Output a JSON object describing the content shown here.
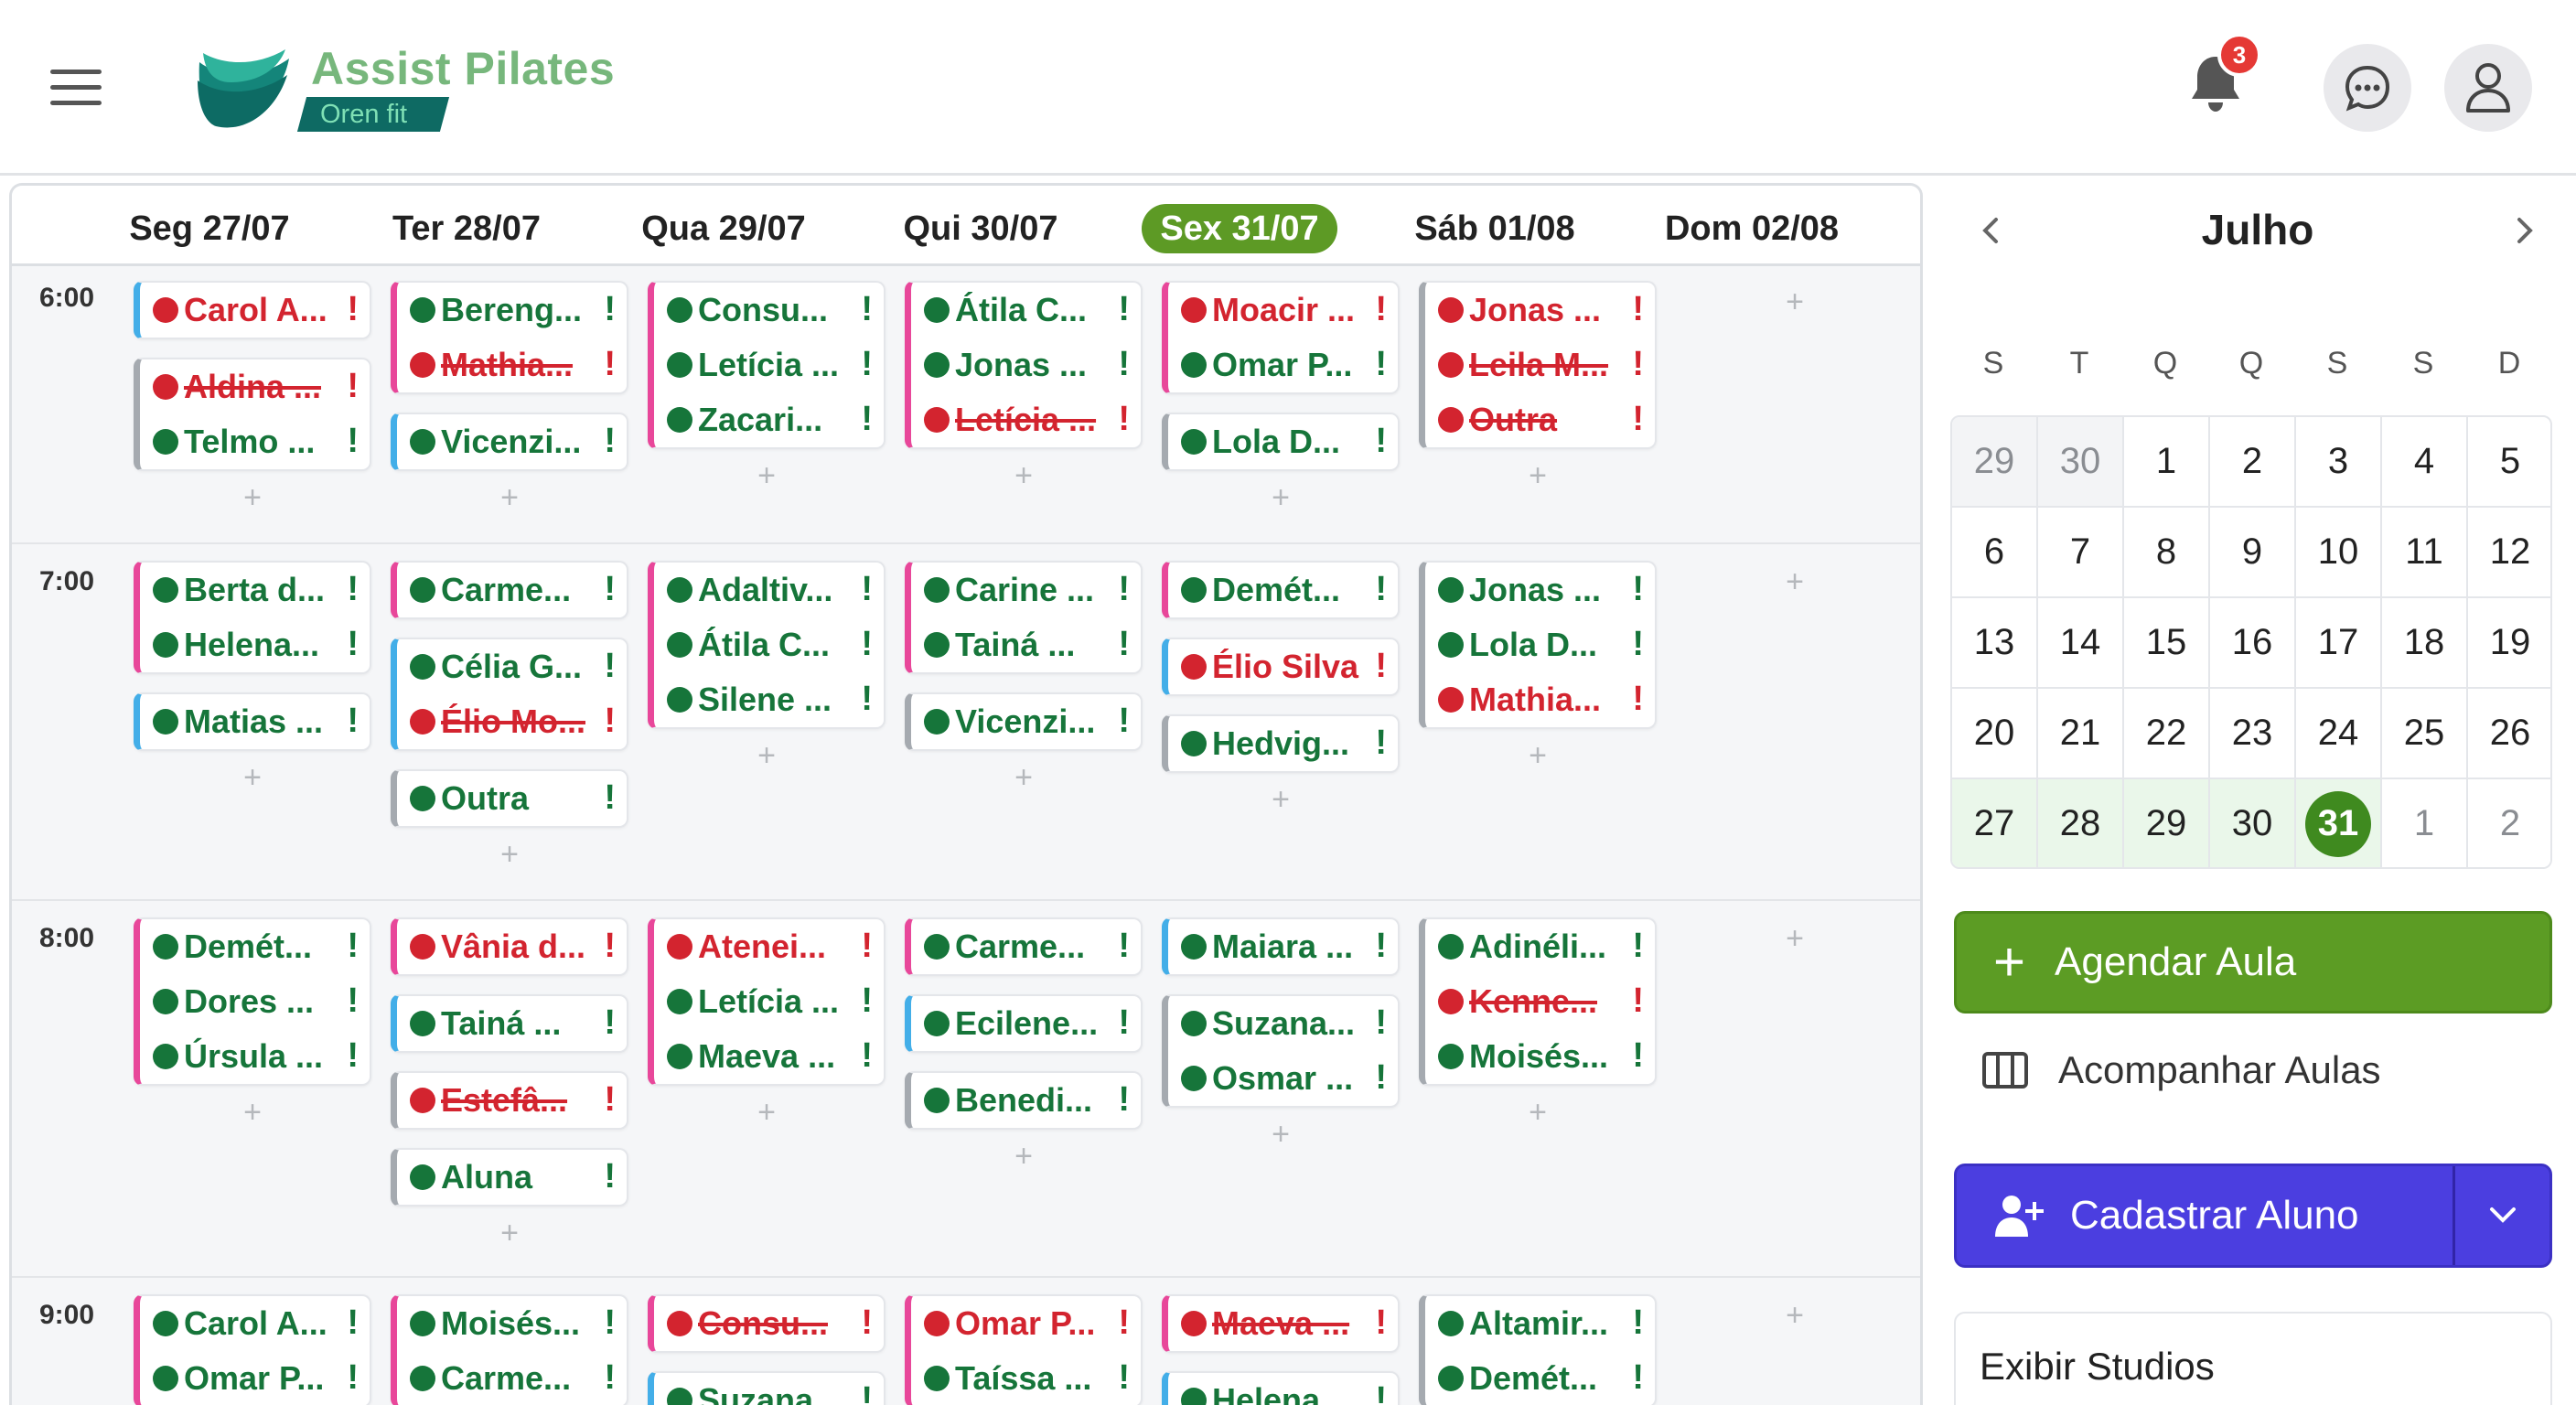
{
  "header": {
    "logo_title": "Assist Pilates",
    "logo_subtitle": "Oren fit",
    "notification_count": "3",
    "icons": [
      "menu-icon",
      "bell-icon",
      "chat-icon",
      "user-icon"
    ]
  },
  "schedule": {
    "days": [
      {
        "label": "Seg 27/07",
        "today": false
      },
      {
        "label": "Ter 28/07",
        "today": false
      },
      {
        "label": "Qua 29/07",
        "today": false
      },
      {
        "label": "Qui 30/07",
        "today": false
      },
      {
        "label": "Sex 31/07",
        "today": true
      },
      {
        "label": "Sáb 01/08",
        "today": false
      },
      {
        "label": "Dom 02/08",
        "today": false
      }
    ],
    "slots": [
      {
        "time": "6:00",
        "days": [
          [
            {
              "color": "blue",
              "entries": [
                {
                  "name": "Carol A...",
                  "status": "red",
                  "strike": false
                }
              ]
            },
            {
              "color": "gray",
              "entries": [
                {
                  "name": "Aldina ...",
                  "status": "red",
                  "strike": true
                },
                {
                  "name": "Telmo ...",
                  "status": "green",
                  "strike": false
                }
              ]
            }
          ],
          [
            {
              "color": "pink",
              "entries": [
                {
                  "name": "Bereng...",
                  "status": "green",
                  "strike": false
                },
                {
                  "name": "Mathia...",
                  "status": "red",
                  "strike": true
                }
              ]
            },
            {
              "color": "blue",
              "entries": [
                {
                  "name": "Vicenzi...",
                  "status": "green",
                  "strike": false
                }
              ]
            }
          ],
          [
            {
              "color": "pink",
              "entries": [
                {
                  "name": "Consu...",
                  "status": "green",
                  "strike": false
                },
                {
                  "name": "Letícia ...",
                  "status": "green",
                  "strike": false
                },
                {
                  "name": "Zacari...",
                  "status": "green",
                  "strike": false
                }
              ]
            }
          ],
          [
            {
              "color": "pink",
              "entries": [
                {
                  "name": "Átila C...",
                  "status": "green",
                  "strike": false
                },
                {
                  "name": "Jonas ...",
                  "status": "green",
                  "strike": false
                },
                {
                  "name": "Letícia ...",
                  "status": "red",
                  "strike": true
                }
              ]
            }
          ],
          [
            {
              "color": "pink",
              "entries": [
                {
                  "name": "Moacir ...",
                  "status": "red",
                  "strike": false
                },
                {
                  "name": "Omar P...",
                  "status": "green",
                  "strike": false
                }
              ]
            },
            {
              "color": "gray",
              "entries": [
                {
                  "name": "Lola D...",
                  "status": "green",
                  "strike": false
                }
              ]
            }
          ],
          [
            {
              "color": "gray",
              "entries": [
                {
                  "name": "Jonas ...",
                  "status": "red",
                  "strike": false
                },
                {
                  "name": "Leila M...",
                  "status": "red",
                  "strike": true
                },
                {
                  "name": "Outra",
                  "status": "red",
                  "strike": true
                }
              ]
            }
          ],
          []
        ]
      },
      {
        "time": "7:00",
        "days": [
          [
            {
              "color": "pink",
              "entries": [
                {
                  "name": "Berta d...",
                  "status": "green",
                  "strike": false
                },
                {
                  "name": "Helena...",
                  "status": "green",
                  "strike": false
                }
              ]
            },
            {
              "color": "blue",
              "entries": [
                {
                  "name": "Matias ...",
                  "status": "green",
                  "strike": false
                }
              ]
            }
          ],
          [
            {
              "color": "pink",
              "entries": [
                {
                  "name": "Carme...",
                  "status": "green",
                  "strike": false
                }
              ]
            },
            {
              "color": "blue",
              "entries": [
                {
                  "name": "Célia G...",
                  "status": "green",
                  "strike": false
                },
                {
                  "name": "Élio Mo...",
                  "status": "red",
                  "strike": true
                }
              ]
            },
            {
              "color": "gray",
              "entries": [
                {
                  "name": "Outra",
                  "status": "green",
                  "strike": false
                }
              ]
            }
          ],
          [
            {
              "color": "pink",
              "entries": [
                {
                  "name": "Adaltiv...",
                  "status": "green",
                  "strike": false
                },
                {
                  "name": "Átila C...",
                  "status": "green",
                  "strike": false
                },
                {
                  "name": "Silene ...",
                  "status": "green",
                  "strike": false
                }
              ]
            }
          ],
          [
            {
              "color": "pink",
              "entries": [
                {
                  "name": "Carine ...",
                  "status": "green",
                  "strike": false
                },
                {
                  "name": "Tainá ...",
                  "status": "green",
                  "strike": false
                }
              ]
            },
            {
              "color": "gray",
              "entries": [
                {
                  "name": "Vicenzi...",
                  "status": "green",
                  "strike": false
                }
              ]
            }
          ],
          [
            {
              "color": "pink",
              "entries": [
                {
                  "name": "Demét...",
                  "status": "green",
                  "strike": false
                }
              ]
            },
            {
              "color": "blue",
              "entries": [
                {
                  "name": "Élio Silva",
                  "status": "red",
                  "strike": false
                }
              ]
            },
            {
              "color": "gray",
              "entries": [
                {
                  "name": "Hedvig...",
                  "status": "green",
                  "strike": false
                }
              ]
            }
          ],
          [
            {
              "color": "gray",
              "entries": [
                {
                  "name": "Jonas ...",
                  "status": "green",
                  "strike": false
                },
                {
                  "name": "Lola D...",
                  "status": "green",
                  "strike": false
                },
                {
                  "name": "Mathia...",
                  "status": "red",
                  "strike": false
                }
              ]
            }
          ],
          []
        ]
      },
      {
        "time": "8:00",
        "days": [
          [
            {
              "color": "pink",
              "entries": [
                {
                  "name": "Demét...",
                  "status": "green",
                  "strike": false
                },
                {
                  "name": "Dores ...",
                  "status": "green",
                  "strike": false
                },
                {
                  "name": "Úrsula ...",
                  "status": "green",
                  "strike": false
                }
              ]
            }
          ],
          [
            {
              "color": "pink",
              "entries": [
                {
                  "name": "Vânia d...",
                  "status": "red",
                  "strike": false
                }
              ]
            },
            {
              "color": "blue",
              "entries": [
                {
                  "name": "Tainá ...",
                  "status": "green",
                  "strike": false
                }
              ]
            },
            {
              "color": "gray",
              "entries": [
                {
                  "name": "Estefâ...",
                  "status": "red",
                  "strike": true
                }
              ]
            },
            {
              "color": "gray",
              "entries": [
                {
                  "name": "Aluna",
                  "status": "green",
                  "strike": false
                }
              ]
            }
          ],
          [
            {
              "color": "pink",
              "entries": [
                {
                  "name": "Atenei...",
                  "status": "red",
                  "strike": false
                },
                {
                  "name": "Letícia ...",
                  "status": "green",
                  "strike": false
                },
                {
                  "name": "Maeva ...",
                  "status": "green",
                  "strike": false
                }
              ]
            }
          ],
          [
            {
              "color": "pink",
              "entries": [
                {
                  "name": "Carme...",
                  "status": "green",
                  "strike": false
                }
              ]
            },
            {
              "color": "blue",
              "entries": [
                {
                  "name": "Ecilene...",
                  "status": "green",
                  "strike": false
                }
              ]
            },
            {
              "color": "gray",
              "entries": [
                {
                  "name": "Benedi...",
                  "status": "green",
                  "strike": false
                }
              ]
            }
          ],
          [
            {
              "color": "blue",
              "entries": [
                {
                  "name": "Maiara ...",
                  "status": "green",
                  "strike": false
                }
              ]
            },
            {
              "color": "gray",
              "entries": [
                {
                  "name": "Suzana...",
                  "status": "green",
                  "strike": false
                },
                {
                  "name": "Osmar ...",
                  "status": "green",
                  "strike": false
                }
              ]
            }
          ],
          [
            {
              "color": "gray",
              "entries": [
                {
                  "name": "Adinéli...",
                  "status": "green",
                  "strike": false
                },
                {
                  "name": "Kenne...",
                  "status": "red",
                  "strike": true
                },
                {
                  "name": "Moisés...",
                  "status": "green",
                  "strike": false
                }
              ]
            }
          ],
          []
        ]
      },
      {
        "time": "9:00",
        "days": [
          [
            {
              "color": "pink",
              "entries": [
                {
                  "name": "Carol A...",
                  "status": "green",
                  "strike": false
                },
                {
                  "name": "Omar P...",
                  "status": "green",
                  "strike": false
                }
              ]
            }
          ],
          [
            {
              "color": "pink",
              "entries": [
                {
                  "name": "Moisés...",
                  "status": "green",
                  "strike": false
                },
                {
                  "name": "Carme...",
                  "status": "green",
                  "strike": false
                }
              ]
            }
          ],
          [
            {
              "color": "pink",
              "entries": [
                {
                  "name": "Consu...",
                  "status": "red",
                  "strike": true
                }
              ]
            },
            {
              "color": "blue",
              "entries": [
                {
                  "name": "Suzana...",
                  "status": "green",
                  "strike": false
                }
              ]
            }
          ],
          [
            {
              "color": "pink",
              "entries": [
                {
                  "name": "Omar P...",
                  "status": "red",
                  "strike": false
                },
                {
                  "name": "Taíssa ...",
                  "status": "green",
                  "strike": false
                }
              ]
            }
          ],
          [
            {
              "color": "pink",
              "entries": [
                {
                  "name": "Maeva ...",
                  "status": "red",
                  "strike": true
                }
              ]
            },
            {
              "color": "blue",
              "entries": [
                {
                  "name": "Helena...",
                  "status": "green",
                  "strike": false
                }
              ]
            }
          ],
          [
            {
              "color": "gray",
              "entries": [
                {
                  "name": "Altamir...",
                  "status": "green",
                  "strike": false
                },
                {
                  "name": "Demét...",
                  "status": "green",
                  "strike": false
                }
              ]
            }
          ],
          []
        ]
      }
    ],
    "warning_mark": "!",
    "add_mark": "+"
  },
  "calendar": {
    "month": "Julho",
    "weekdays": [
      "S",
      "T",
      "Q",
      "Q",
      "S",
      "S",
      "D"
    ],
    "weeks": [
      [
        {
          "d": "29",
          "m": true
        },
        {
          "d": "30",
          "m": true
        },
        {
          "d": "1"
        },
        {
          "d": "2"
        },
        {
          "d": "3"
        },
        {
          "d": "4"
        },
        {
          "d": "5"
        }
      ],
      [
        {
          "d": "6"
        },
        {
          "d": "7"
        },
        {
          "d": "8"
        },
        {
          "d": "9"
        },
        {
          "d": "10"
        },
        {
          "d": "11"
        },
        {
          "d": "12"
        }
      ],
      [
        {
          "d": "13"
        },
        {
          "d": "14"
        },
        {
          "d": "15"
        },
        {
          "d": "16"
        },
        {
          "d": "17"
        },
        {
          "d": "18"
        },
        {
          "d": "19"
        }
      ],
      [
        {
          "d": "20"
        },
        {
          "d": "21"
        },
        {
          "d": "22"
        },
        {
          "d": "23"
        },
        {
          "d": "24"
        },
        {
          "d": "25"
        },
        {
          "d": "26"
        }
      ],
      [
        {
          "d": "27",
          "w": true
        },
        {
          "d": "28",
          "w": true
        },
        {
          "d": "29",
          "w": true
        },
        {
          "d": "30",
          "w": true
        },
        {
          "d": "31",
          "w": true,
          "today": true
        },
        {
          "d": "1",
          "m": true,
          "w": true
        },
        {
          "d": "2",
          "m": true,
          "w": true
        }
      ]
    ]
  },
  "actions": {
    "schedule_label": "Agendar Aula",
    "track_label": "Acompanhar Aulas",
    "register_label": "Cadastrar Aluno",
    "studios_label": "Exibir Studios"
  },
  "colors": {
    "accent_green": "#5c9c24",
    "today_green": "#3f8a1f",
    "primary_blue": "#4b3ee0",
    "status_green": "#16753a",
    "status_red": "#d3242f",
    "card_pink": "#e8479a",
    "card_blue": "#43aee8",
    "card_gray": "#a5aab0",
    "logo_green": "#77b77c",
    "logo_teal": "#0e6a63"
  }
}
